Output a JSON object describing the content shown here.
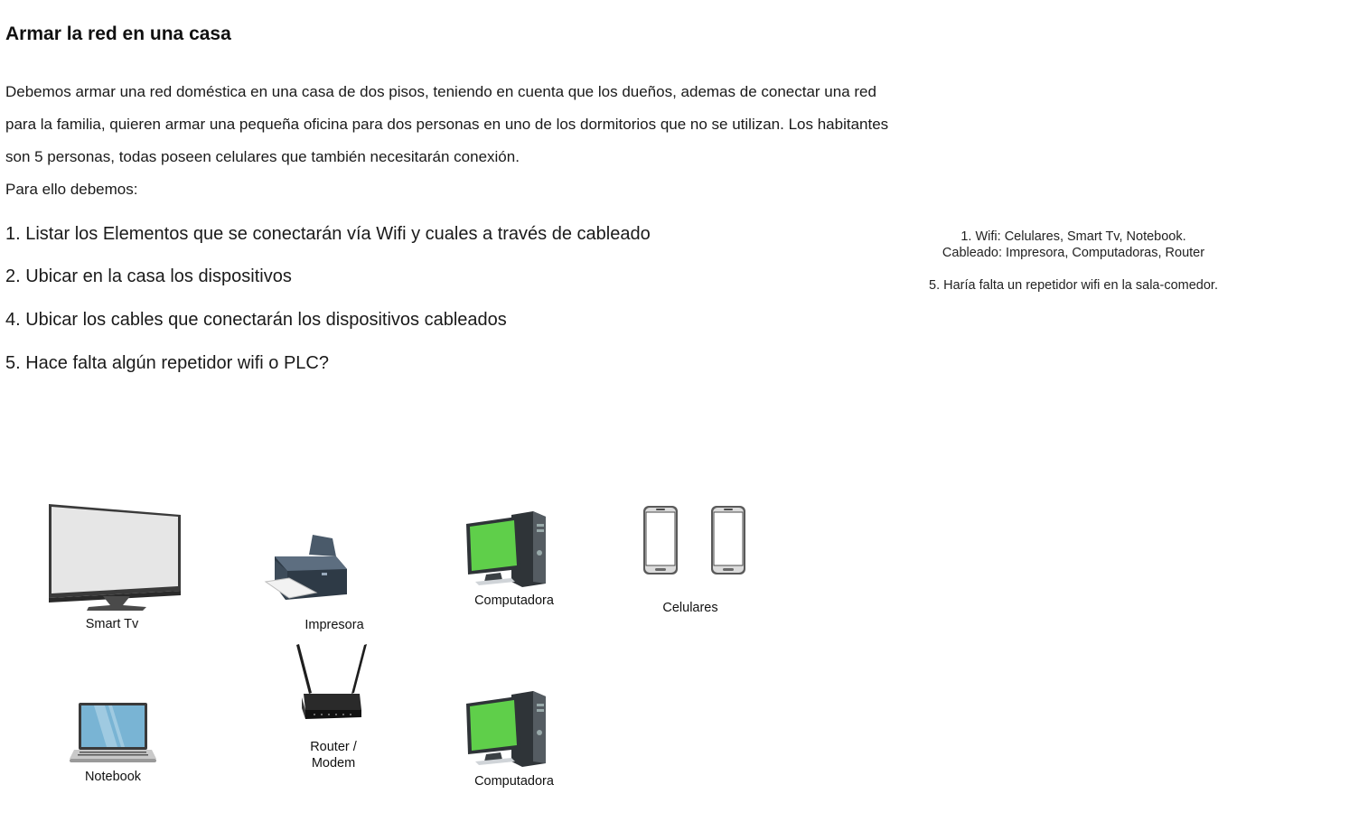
{
  "title": "Armar la red en una casa",
  "intro": {
    "paragraph": "Debemos armar una red doméstica en una casa de dos pisos, teniendo en cuenta que los dueños, ademas de conectar una red para la familia, quieren armar una pequeña oficina para dos personas en uno de los dormitorios que no se utilizan. Los habitantes son 5 personas, todas poseen celulares que también necesitarán conexión.",
    "lead": "Para ello debemos:"
  },
  "tasks": [
    "1. Listar los Elementos que se conectarán vía Wifi y cuales a través de cableado",
    "2. Ubicar en la casa los dispositivos",
    "4. Ubicar los cables que conectarán los dispositivos cableados",
    "5. Hace falta algún repetidor wifi o PLC?"
  ],
  "answers": {
    "line1": "1. Wifi: Celulares, Smart Tv, Notebook.",
    "line2": "Cableado: Impresora, Computadoras, Router",
    "line3": "5. Haría falta un repetidor wifi en la sala-comedor."
  },
  "devices": {
    "smart_tv": {
      "label": "Smart Tv",
      "icon": "smart-tv-icon"
    },
    "printer": {
      "label": "Impresora",
      "icon": "printer-icon"
    },
    "computer_top": {
      "label": "Computadora",
      "icon": "desktop-computer-icon"
    },
    "phones": {
      "label": "Celulares",
      "icon": "smartphone-icon"
    },
    "notebook": {
      "label": "Notebook",
      "icon": "laptop-icon"
    },
    "router": {
      "label_line1": "Router /",
      "label_line2": "Modem",
      "icon": "router-icon"
    },
    "computer_bottom": {
      "label": "Computadora",
      "icon": "desktop-computer-icon"
    }
  },
  "colors": {
    "monitor_screen": "#5fcf4a",
    "tv_screen": "#e6e6e6",
    "laptop_screen": "#79b4d4"
  }
}
